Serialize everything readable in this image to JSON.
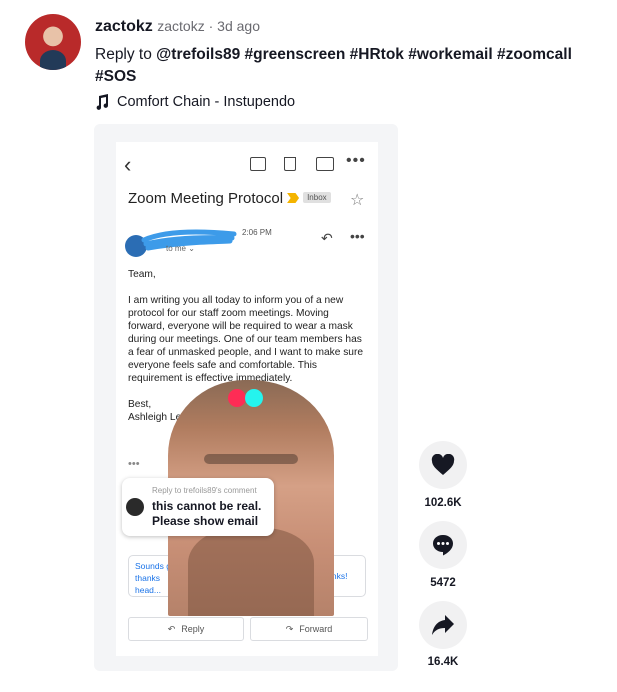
{
  "post": {
    "username": "zactokz",
    "meta": "zactokz · 3d ago",
    "caption_prefix": "Reply to ",
    "mention": "@trefoils89",
    "hashtags": "#greenscreen #HRtok #workemail #zoomcall #SOS",
    "music_icon": "music-note-icon",
    "music": "Comfort Chain - Instupendo"
  },
  "email": {
    "subject": "Zoom Meeting Protocol",
    "label": "Inbox",
    "time": "2:06 PM",
    "to": "to me ⌄",
    "body": "Team,\n\nI am writing you all today to inform you of a new protocol for our staff zoom meetings. Moving forward, everyone will be required to wear a mask during our meetings. One of our team members has a fear of unmasked people, and I want to make sure everyone feels safe and comfortable. This requirement is effective immediately.\n\nBest,\nAshleigh LeighAnn",
    "ellipsis": "•••",
    "quick_left": "Sounds g...\nthanks\nhead...",
    "quick_right": "...thanks!",
    "reply": "Reply",
    "forward": "Forward"
  },
  "reply_card": {
    "header": "Reply to trefoils89's comment",
    "text": "this cannot be real. Please show email"
  },
  "actions": {
    "likes": "102.6K",
    "comments": "5472",
    "shares": "16.4K"
  },
  "colors": {
    "tiktok_red": "#fe2c55",
    "tiktok_cyan": "#25f4ee",
    "scribble_blue": "#3d9be9",
    "link_blue": "#1a73e8"
  }
}
